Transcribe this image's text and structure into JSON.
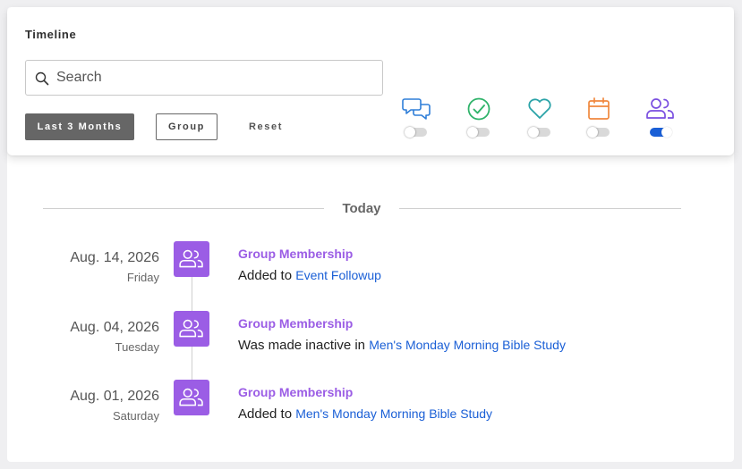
{
  "timeline": {
    "title": "Timeline",
    "search": {
      "placeholder": "Search",
      "value": ""
    },
    "buttons": {
      "last3": "Last 3 Months",
      "group": "Group",
      "reset": "Reset"
    },
    "filters": [
      {
        "icon": "chat-bubbles-icon",
        "color": "#2f7ed8",
        "enabled": false
      },
      {
        "icon": "check-circle-icon",
        "color": "#2fb36a",
        "enabled": false
      },
      {
        "icon": "heart-icon",
        "color": "#2ba3a8",
        "enabled": false
      },
      {
        "icon": "calendar-icon",
        "color": "#f0883e",
        "enabled": false
      },
      {
        "icon": "group-icon",
        "color": "#7a4fe0",
        "enabled": true
      }
    ]
  },
  "divider": {
    "label": "Today"
  },
  "entries": [
    {
      "date": "Aug. 14, 2026",
      "day": "Friday",
      "title": "Group Membership",
      "text": "Added to",
      "link": "Event Followup",
      "badge_icon": "group-icon"
    },
    {
      "date": "Aug. 04, 2026",
      "day": "Tuesday",
      "title": "Group Membership",
      "text": "Was made inactive in",
      "link": "Men's Monday Morning Bible Study",
      "badge_icon": "group-icon"
    },
    {
      "date": "Aug. 01, 2026",
      "day": "Saturday",
      "title": "Group Membership",
      "text": "Added to",
      "link": "Men's Monday Morning Bible Study",
      "badge_icon": "group-icon"
    }
  ],
  "colors": {
    "accent_purple": "#9b5de5",
    "link_blue": "#1a5fd6",
    "button_dark": "#666666"
  }
}
